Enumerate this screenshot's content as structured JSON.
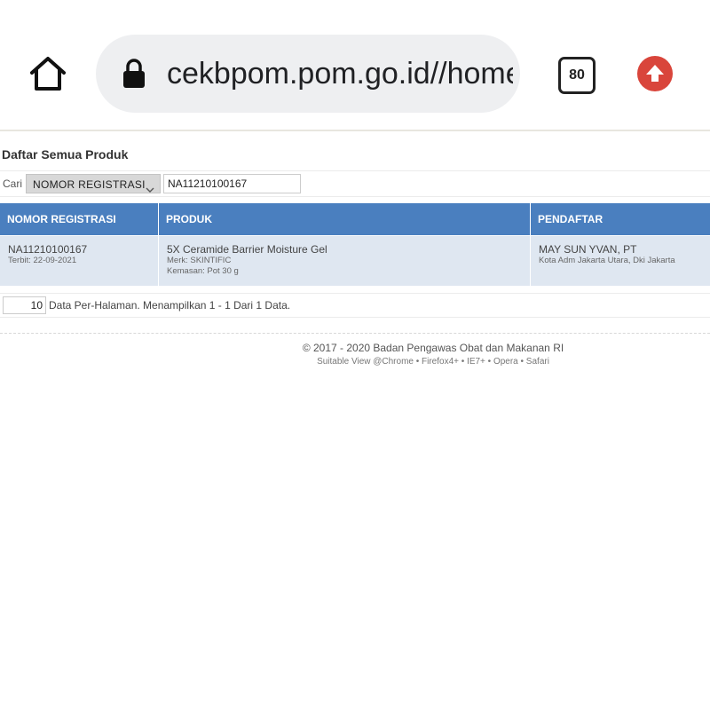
{
  "browser": {
    "url": "cekbpom.pom.go.id//home",
    "tab_count": "80"
  },
  "page": {
    "title": "Daftar Semua Produk"
  },
  "search": {
    "label": "Cari",
    "field_selected": "NOMOR REGISTRASI",
    "value": "NA11210100167"
  },
  "table": {
    "headers": [
      "NOMOR REGISTRASI",
      "PRODUK",
      "PENDAFTAR"
    ],
    "rows": [
      {
        "nomor_registrasi": "NA11210100167",
        "terbit": "Terbit: 22-09-2021",
        "produk": "5X Ceramide Barrier Moisture Gel",
        "merk": "Merk: SKINTIFIC",
        "kemasan": "Kemasan: Pot 30 g",
        "pendaftar": "MAY SUN YVAN, PT",
        "alamat": "Kota Adm Jakarta Utara, Dki Jakarta"
      }
    ]
  },
  "pager": {
    "per_page": "10",
    "summary": "Data Per-Halaman. Menampilkan 1 - 1 Dari 1 Data."
  },
  "footer": {
    "copyright": "© 2017 - 2020  Badan Pengawas Obat dan Makanan RI",
    "browsers": "Suitable View @Chrome • Firefox4+ • IE7+ • Opera • Safari"
  },
  "colors": {
    "header_blue": "#4a7fbf",
    "row_bg": "#dfe7f1",
    "update_red": "#d9453b"
  },
  "icons": [
    "home-icon",
    "lock-icon",
    "tab-switcher-icon",
    "update-arrow-icon",
    "chevron-down-icon"
  ]
}
